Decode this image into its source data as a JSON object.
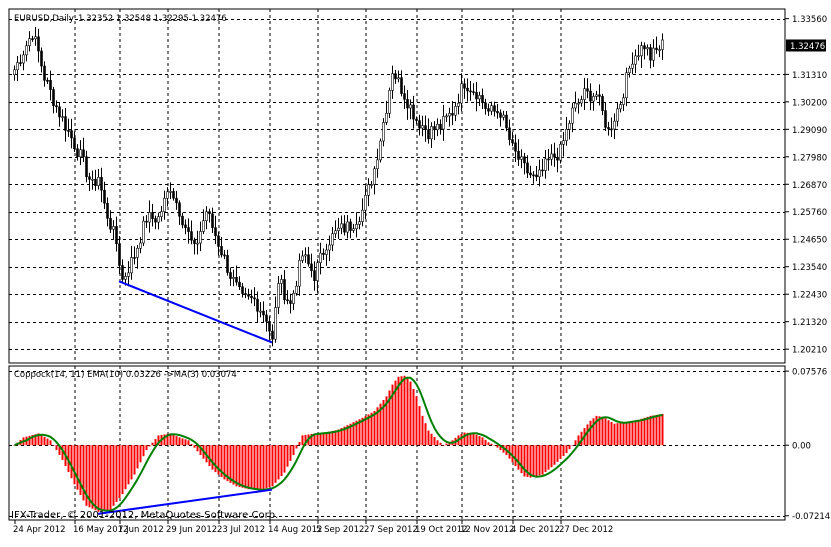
{
  "chart_data": [
    {
      "type": "candlestick",
      "symbol_label": "EURUSD,Daily",
      "ohlc_label": "1.32352 1.32548 1.32295 1.32476",
      "last_price_label": "1.32476",
      "ylim": [
        1.1965,
        1.3395
      ],
      "y_ticks": [
        {
          "v": 1.3356,
          "label": "1.33560"
        },
        {
          "v": 1.32476,
          "label": "1.32476"
        },
        {
          "v": 1.3131,
          "label": "1.31310"
        },
        {
          "v": 1.302,
          "label": "1.30200"
        },
        {
          "v": 1.2909,
          "label": "1.29090"
        },
        {
          "v": 1.2798,
          "label": "1.27980"
        },
        {
          "v": 1.2687,
          "label": "1.26870"
        },
        {
          "v": 1.2576,
          "label": "1.25760"
        },
        {
          "v": 1.2465,
          "label": "1.24650"
        },
        {
          "v": 1.2354,
          "label": "1.23540"
        },
        {
          "v": 1.2243,
          "label": "1.22430"
        },
        {
          "v": 1.2132,
          "label": "1.21320"
        },
        {
          "v": 1.2021,
          "label": "1.20210"
        }
      ],
      "price_anchors": [
        [
          0,
          1.315
        ],
        [
          4,
          1.325
        ],
        [
          6,
          1.33
        ],
        [
          8,
          1.322
        ],
        [
          10,
          1.312
        ],
        [
          14,
          1.3
        ],
        [
          18,
          1.29
        ],
        [
          22,
          1.28
        ],
        [
          26,
          1.268
        ],
        [
          28,
          1.272
        ],
        [
          30,
          1.26
        ],
        [
          34,
          1.245
        ],
        [
          36,
          1.23
        ],
        [
          40,
          1.24
        ],
        [
          44,
          1.255
        ],
        [
          48,
          1.255
        ],
        [
          52,
          1.268
        ],
        [
          56,
          1.255
        ],
        [
          60,
          1.242
        ],
        [
          64,
          1.258
        ],
        [
          68,
          1.245
        ],
        [
          72,
          1.232
        ],
        [
          76,
          1.222
        ],
        [
          80,
          1.222
        ],
        [
          84,
          1.215
        ],
        [
          86,
          1.205
        ],
        [
          88,
          1.23
        ],
        [
          92,
          1.22
        ],
        [
          96,
          1.24
        ],
        [
          100,
          1.232
        ],
        [
          104,
          1.245
        ],
        [
          108,
          1.25
        ],
        [
          112,
          1.252
        ],
        [
          116,
          1.258
        ],
        [
          120,
          1.275
        ],
        [
          124,
          1.3
        ],
        [
          126,
          1.315
        ],
        [
          130,
          1.305
        ],
        [
          134,
          1.295
        ],
        [
          138,
          1.29
        ],
        [
          142,
          1.292
        ],
        [
          146,
          1.298
        ],
        [
          150,
          1.31
        ],
        [
          154,
          1.306
        ],
        [
          158,
          1.298
        ],
        [
          162,
          1.298
        ],
        [
          166,
          1.283
        ],
        [
          170,
          1.275
        ],
        [
          174,
          1.27
        ],
        [
          178,
          1.278
        ],
        [
          182,
          1.282
        ],
        [
          186,
          1.298
        ],
        [
          190,
          1.305
        ],
        [
          194,
          1.305
        ],
        [
          198,
          1.29
        ],
        [
          202,
          1.302
        ],
        [
          206,
          1.32
        ],
        [
          210,
          1.325
        ],
        [
          212,
          1.32
        ],
        [
          216,
          1.325
        ]
      ],
      "trendline": {
        "start": [
          35,
          1.2295
        ],
        "end": [
          86,
          1.2048
        ],
        "color": "#0000ff"
      }
    },
    {
      "type": "bar",
      "indicator_label": "Coppock(14, 11) EMA(10) 0.03226 ->MA(3) 0.03074",
      "ylim": [
        -0.0765,
        0.081
      ],
      "y_ticks": [
        {
          "v": 0.07576,
          "label": "0.07576"
        },
        {
          "v": 0.0,
          "label": "0.00"
        },
        {
          "v": -0.07214,
          "label": "-0.07214"
        }
      ],
      "value_anchors": [
        [
          0,
          0.0
        ],
        [
          3,
          0.008
        ],
        [
          8,
          0.012
        ],
        [
          12,
          0.005
        ],
        [
          16,
          -0.015
        ],
        [
          20,
          -0.04
        ],
        [
          24,
          -0.062
        ],
        [
          28,
          -0.068
        ],
        [
          32,
          -0.066
        ],
        [
          36,
          -0.05
        ],
        [
          40,
          -0.03
        ],
        [
          44,
          -0.005
        ],
        [
          48,
          0.01
        ],
        [
          52,
          0.012
        ],
        [
          55,
          0.008
        ],
        [
          58,
          0.005
        ],
        [
          62,
          -0.01
        ],
        [
          66,
          -0.025
        ],
        [
          70,
          -0.035
        ],
        [
          74,
          -0.042
        ],
        [
          78,
          -0.045
        ],
        [
          82,
          -0.046
        ],
        [
          86,
          -0.042
        ],
        [
          90,
          -0.028
        ],
        [
          93,
          -0.01
        ],
        [
          96,
          0.01
        ],
        [
          100,
          0.012
        ],
        [
          104,
          0.013
        ],
        [
          108,
          0.016
        ],
        [
          112,
          0.022
        ],
        [
          116,
          0.028
        ],
        [
          120,
          0.035
        ],
        [
          124,
          0.05
        ],
        [
          126,
          0.062
        ],
        [
          128,
          0.07
        ],
        [
          130,
          0.071
        ],
        [
          132,
          0.065
        ],
        [
          134,
          0.05
        ],
        [
          136,
          0.03
        ],
        [
          138,
          0.015
        ],
        [
          141,
          0.005
        ],
        [
          143,
          0.0
        ],
        [
          146,
          0.005
        ],
        [
          148,
          0.01
        ],
        [
          150,
          0.013
        ],
        [
          153,
          0.012
        ],
        [
          156,
          0.008
        ],
        [
          158,
          0.003
        ],
        [
          160,
          0.0
        ],
        [
          164,
          -0.01
        ],
        [
          168,
          -0.025
        ],
        [
          170,
          -0.032
        ],
        [
          172,
          -0.033
        ],
        [
          176,
          -0.03
        ],
        [
          180,
          -0.02
        ],
        [
          184,
          -0.008
        ],
        [
          186,
          0.0
        ],
        [
          188,
          0.01
        ],
        [
          192,
          0.025
        ],
        [
          194,
          0.03
        ],
        [
          196,
          0.029
        ],
        [
          200,
          0.022
        ],
        [
          204,
          0.024
        ],
        [
          208,
          0.026
        ],
        [
          212,
          0.03
        ],
        [
          216,
          0.032
        ]
      ],
      "ma_period": 3,
      "trendline": {
        "start": [
          28,
          -0.0702
        ],
        "end": [
          86,
          -0.0455
        ],
        "color": "#0000ff"
      }
    }
  ],
  "n_bars": 217,
  "x_tick_labels": [
    {
      "i": 0,
      "label": "24 Apr 2012"
    },
    {
      "i": 20,
      "label": "16 May 2012"
    },
    {
      "i": 35,
      "label": "7 Jun 2012"
    },
    {
      "i": 51,
      "label": "29 Jun 2012"
    },
    {
      "i": 68,
      "label": "23 Jul 2012"
    },
    {
      "i": 85,
      "label": "14 Aug 2012"
    },
    {
      "i": 101,
      "label": "5 Sep 2012"
    },
    {
      "i": 117,
      "label": "27 Sep 2012"
    },
    {
      "i": 134,
      "label": "19 Oct 2012"
    },
    {
      "i": 149,
      "label": "12 Nov 2012"
    },
    {
      "i": 166,
      "label": "4 Dec 2012"
    },
    {
      "i": 182,
      "label": "27 Dec 2012"
    }
  ],
  "copyright_text": "IFX-Trader, © 2001-2012, MetaQuotes Software Corp.",
  "colors": {
    "background": "#ffffff",
    "frame": "#000000",
    "grid": "#000000",
    "candle": "#000000",
    "histogram": "#ff0000",
    "signal_line": "#008000",
    "trendline": "#0000ff",
    "last_price_bg": "#000000",
    "last_price_text": "#ffffff"
  }
}
